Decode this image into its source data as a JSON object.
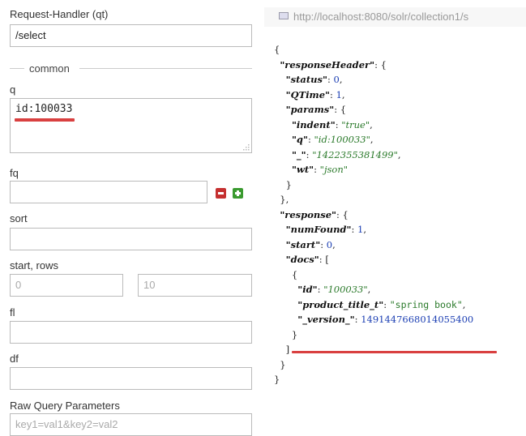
{
  "form": {
    "request_handler": {
      "label": "Request-Handler (qt)",
      "value": "/select"
    },
    "common_legend": "common",
    "q": {
      "label": "q",
      "value": "id:100033"
    },
    "fq": {
      "label": "fq",
      "value": ""
    },
    "sort": {
      "label": "sort",
      "value": ""
    },
    "start_rows": {
      "label": "start, rows",
      "start_placeholder": "0",
      "rows_placeholder": "10"
    },
    "fl": {
      "label": "fl",
      "value": ""
    },
    "df": {
      "label": "df",
      "value": ""
    },
    "raw": {
      "label": "Raw Query Parameters",
      "placeholder": "key1=val1&key2=val2"
    }
  },
  "result": {
    "url": "http://localhost:8080/solr/collection1/s",
    "status": "0",
    "qtime": "1",
    "indent": "\"true\"",
    "q": "\"id:100033\"",
    "underscore": "\"1422355381499\"",
    "wt": "\"json\"",
    "numFound": "1",
    "start": "0",
    "doc_id": "\"100033\"",
    "product_title_t": "\"spring book\"",
    "version": "1491447668014055400"
  },
  "colors": {
    "highlight": "#d94040",
    "number": "#1c3fb3",
    "string": "#2b7a2b"
  }
}
